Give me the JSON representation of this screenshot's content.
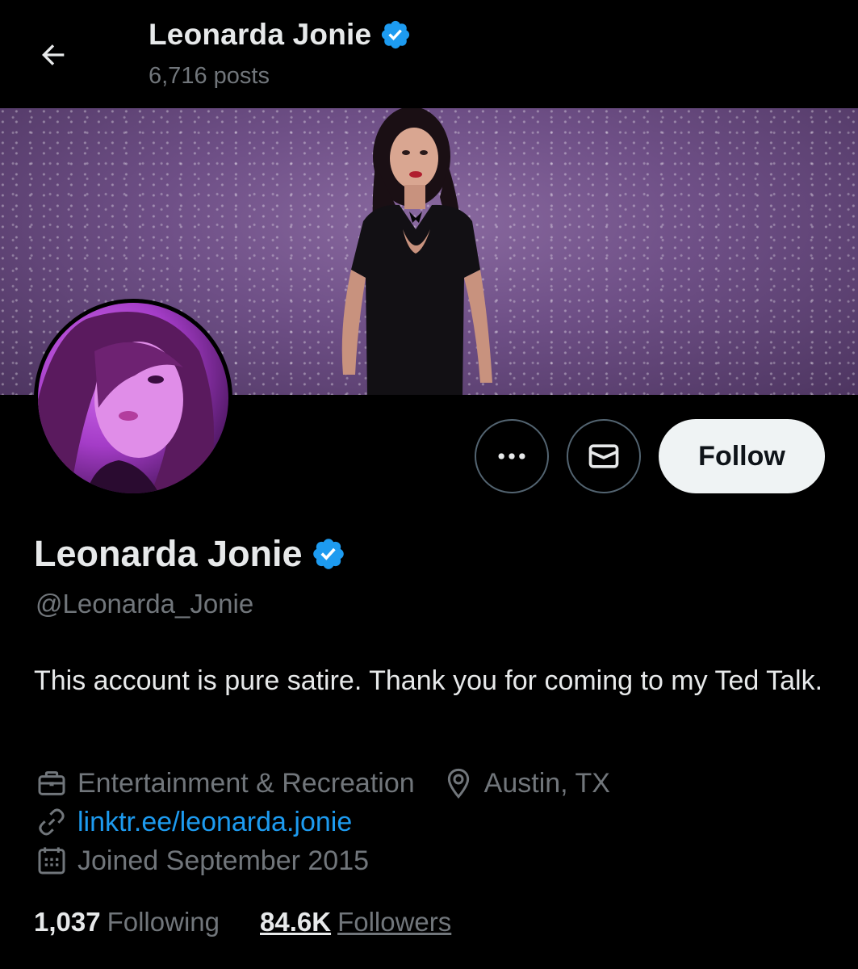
{
  "header": {
    "name": "Leonarda Jonie",
    "posts": "6,716 posts",
    "back_icon": "arrow-left-icon",
    "verified_icon": "verified-badge-icon"
  },
  "banner": {
    "description_icon": "banner-image"
  },
  "actions": {
    "more_icon": "more-horizontal-icon",
    "message_icon": "envelope-icon",
    "follow_label": "Follow"
  },
  "profile": {
    "name": "Leonarda Jonie",
    "handle": "@Leonarda_Jonie",
    "bio": "This account is pure satire. Thank you for coming to my Ted Talk.",
    "category": "Entertainment & Recreation",
    "location": "Austin, TX",
    "link": "linktr.ee/leonarda.jonie",
    "joined": "Joined September 2015"
  },
  "stats": {
    "following_count": "1,037",
    "following_label": "Following",
    "followers_count": "84.6K",
    "followers_label": "Followers"
  },
  "colors": {
    "background": "#000000",
    "text_primary": "#e7e9ea",
    "text_secondary": "#71767b",
    "link": "#1d9bf0",
    "verified": "#1d9bf0",
    "follow_button_bg": "#eff3f4"
  }
}
